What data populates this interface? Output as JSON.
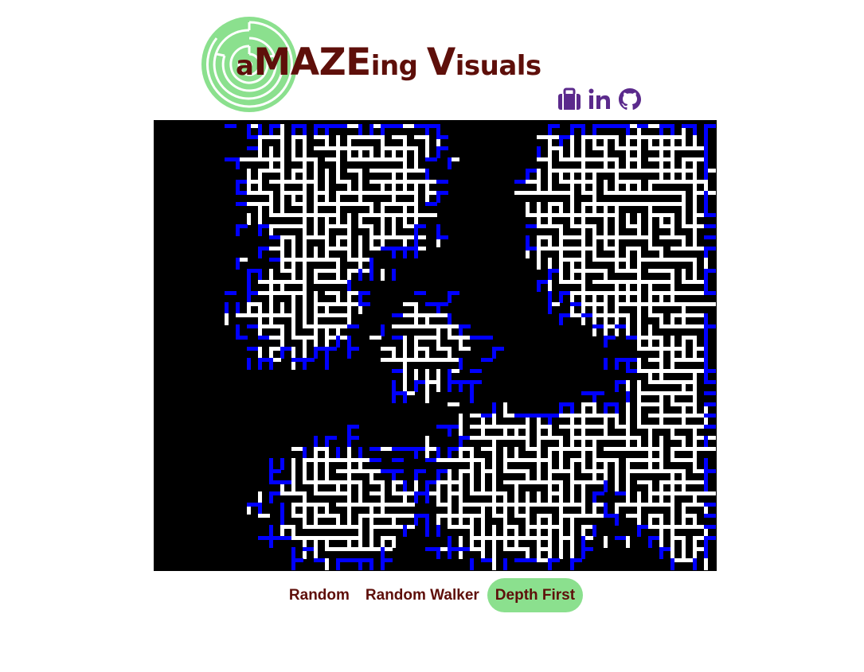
{
  "header": {
    "wordmark_prefix": "a",
    "wordmark_main": "MAZE",
    "wordmark_mid": "ing ",
    "wordmark_v": "V",
    "wordmark_rest": "isuals",
    "icons": [
      "briefcase-icon",
      "linkedin-icon",
      "github-icon"
    ]
  },
  "colors": {
    "brand_dark": "#5e0f0a",
    "brand_green": "#8be08e",
    "icon_purple": "#5b2a8c",
    "maze_wall": "#000000",
    "maze_path": "#ffffff",
    "maze_frontier": "#0000ff"
  },
  "tabs": [
    {
      "label": "Random",
      "active": false
    },
    {
      "label": "Random Walker",
      "active": false
    },
    {
      "label": "Depth First",
      "active": true
    }
  ]
}
